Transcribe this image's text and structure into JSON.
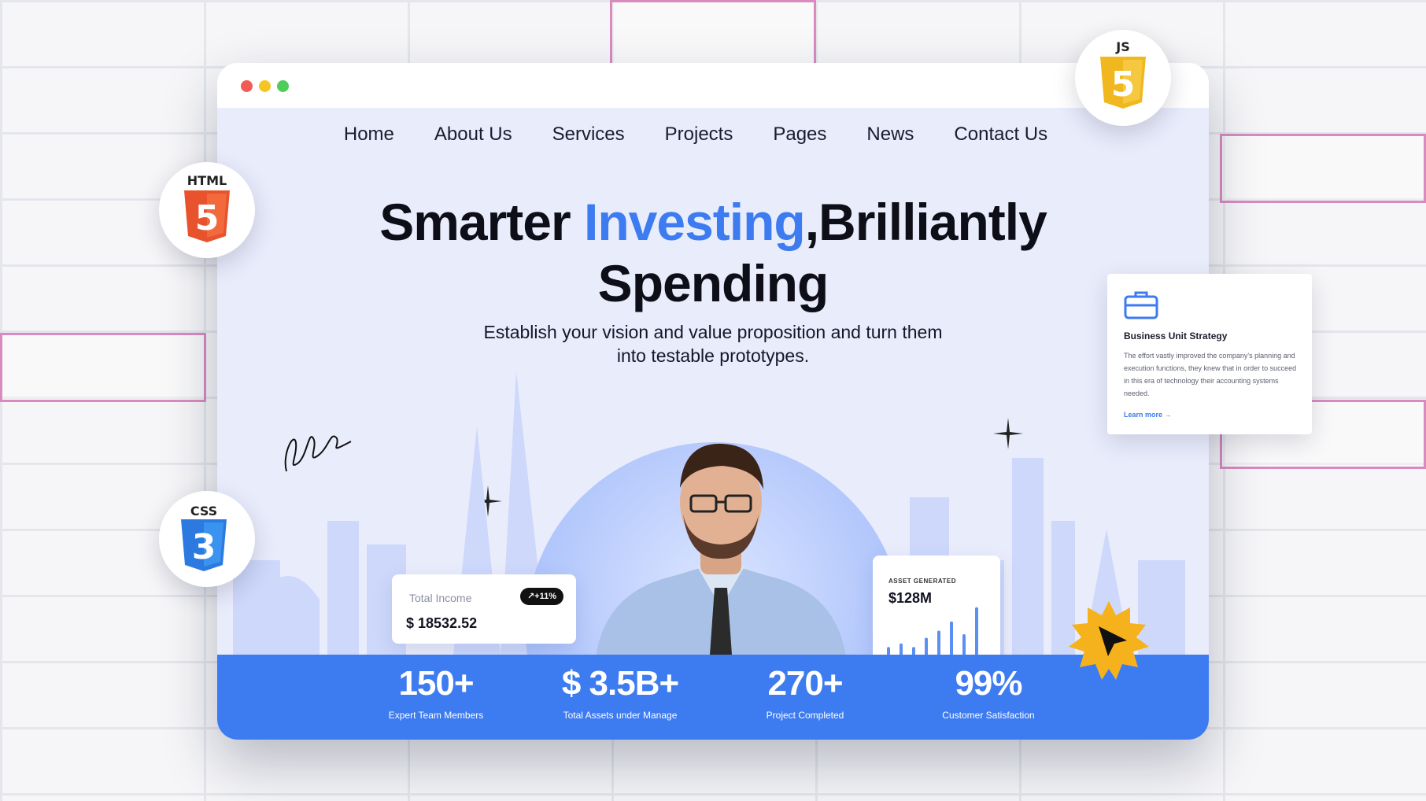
{
  "nav": {
    "items": [
      "Home",
      "About Us",
      "Services",
      "Projects",
      "Pages",
      "News",
      "Contact Us"
    ]
  },
  "hero": {
    "headline_part1": "Smarter ",
    "headline_highlight": "Investing",
    "headline_part2": ",Brilliantly",
    "headline_line2": "Spending",
    "subtitle_line1": "Establish your vision and value proposition and turn them",
    "subtitle_line2": "into testable prototypes."
  },
  "income_card": {
    "label": "Total Income",
    "value": "$ 18532.52",
    "change": "+11%"
  },
  "asset_card": {
    "label": "ASSET GENERATED",
    "value": "$128M",
    "bar_levels": [
      0.42,
      0.47,
      0.42,
      0.55,
      0.65,
      0.78,
      0.6,
      0.98
    ]
  },
  "stats": [
    {
      "value": "150+",
      "label": "Expert Team Members"
    },
    {
      "value": "$ 3.5B+",
      "label": "Total Assets under Manage"
    },
    {
      "value": "270+",
      "label": "Project Completed"
    },
    {
      "value": "99%",
      "label": "Customer Satisfaction"
    }
  ],
  "badges": {
    "html": "HTML",
    "html_number": "5",
    "css": "CSS",
    "css_number": "3",
    "js": "JS",
    "js_number": "5"
  },
  "strategy_card": {
    "title": "Business Unit Strategy",
    "body": "The effort vastly improved the company's planning and execution functions, they knew that in order to succeed in this era of technology their accounting systems needed.",
    "link": "Learn more →"
  },
  "colors": {
    "accent": "#3d7bf0",
    "hero_bg": "#e9ecfb",
    "html_orange": "#e8522c",
    "css_blue": "#2c7ae0",
    "js_yellow": "#f0b81e"
  }
}
